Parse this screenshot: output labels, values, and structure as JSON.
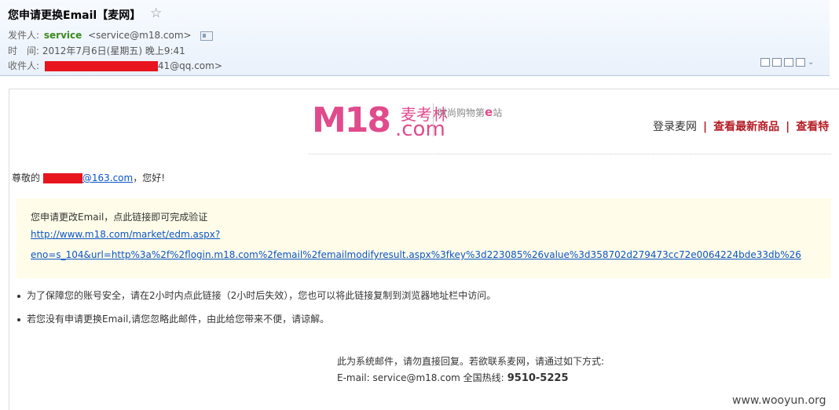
{
  "header": {
    "subject": "您申请更换Email【麦网】",
    "star_icon": "☆",
    "from_label": "发件人:",
    "from_name": "service",
    "from_addr": "<service@m18.com>",
    "time_label": "时　间:",
    "time_value": "2012年7月6日(星期五) 晚上9:41",
    "to_label": "收件人:",
    "to_addr_tail": "41@qq.com>",
    "icons": [
      "contact-card-icon",
      "window-icon",
      "note-icon",
      "export-icon",
      "print-icon",
      "chevron-down-icon"
    ]
  },
  "brand": {
    "logo_m18": "M18",
    "logo_zh": "麦考林",
    "logo_com": ".com",
    "slogan_pre": "时尚购物第",
    "slogan_e": "e",
    "slogan_post": "站",
    "accent_color": "#e04b8c"
  },
  "nav": {
    "login": "登录麦网",
    "sep": "|",
    "latest": "查看最新商品",
    "more": "查看特"
  },
  "body": {
    "greeting_pre": "尊敬的",
    "greeting_mail": "@163.com",
    "greeting_post": "，您好!",
    "box_text": "您申请更改Email，点此链接即可完成验证",
    "link_line1": "http://www.m18.com/market/edm.aspx?",
    "link_line2": "eno=s_104&url=http%3a%2f%2flogin.m18.com%2femail%2femailmodifyresult.aspx%3fkey%3d223085%26value%3d358702d279473cc72e0064224bde33db%26",
    "note1": "为了保障您的账号安全，请在2小时内点此链接（2小时后失效），您也可以将此链接复制到浏览器地址栏中访问。",
    "note2": "若您没有申请更换Email,请您忽略此邮件，由此给您带来不便，请谅解。"
  },
  "footer": {
    "line1": "此为系统邮件，请勿直接回复。若欲联系麦网，请通过如下方式:",
    "email_line": "E-mail: service@m18.com 全国热线:",
    "phone": "9510-5225"
  },
  "watermark": "www.wooyun.org"
}
